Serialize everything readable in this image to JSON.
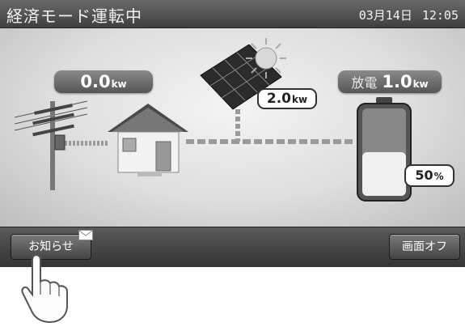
{
  "header": {
    "mode": "経済モード運転中",
    "date": "03月14日",
    "time": "12:05"
  },
  "flows": {
    "grid": {
      "value": "0.0",
      "unit": "kw"
    },
    "solar": {
      "value": "2.0",
      "unit": "kw"
    },
    "battery": {
      "label": "放電",
      "value": "1.0",
      "unit": "kw",
      "charge_value": "50",
      "charge_unit": "%",
      "charge_level": 0.5
    }
  },
  "footer": {
    "notice_label": "お知らせ",
    "screen_off_label": "画面オフ"
  },
  "icons": [
    "power-pole-icon",
    "house-icon",
    "solar-panel-icon",
    "sun-icon",
    "battery-icon",
    "mail-icon",
    "pointing-hand-icon"
  ],
  "colors": {
    "bar": "#3f3f3f",
    "stage": "#e6e6e6",
    "text": "#ffffff"
  }
}
